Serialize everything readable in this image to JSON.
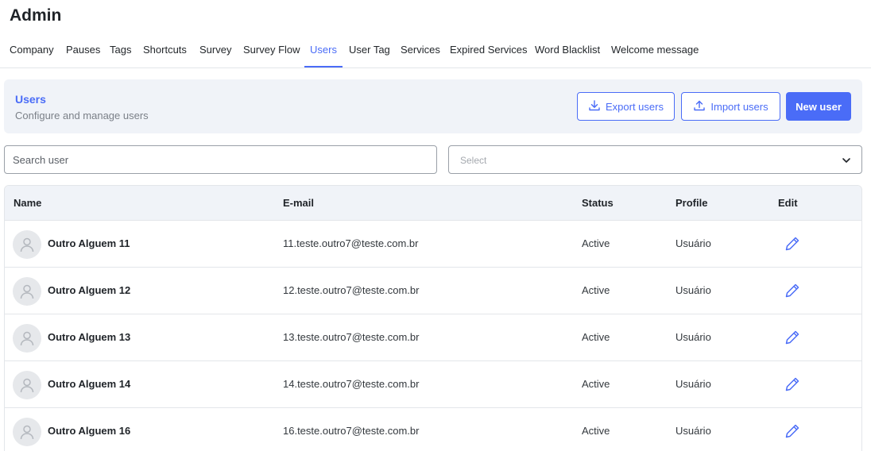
{
  "page": {
    "title": "Admin"
  },
  "tabs": [
    {
      "label": "Company",
      "active": false
    },
    {
      "label": "Pauses",
      "active": false
    },
    {
      "label": "Tags",
      "active": false
    },
    {
      "label": "Shortcuts",
      "active": false
    },
    {
      "label": "Survey",
      "active": false
    },
    {
      "label": "Survey Flow",
      "active": false
    },
    {
      "label": "Users",
      "active": true
    },
    {
      "label": "User Tag",
      "active": false
    },
    {
      "label": "Services",
      "active": false
    },
    {
      "label": "Expired Services",
      "active": false
    },
    {
      "label": "Word Blacklist",
      "active": false
    },
    {
      "label": "Welcome message",
      "active": false
    }
  ],
  "banner": {
    "title": "Users",
    "subtitle": "Configure and manage users",
    "export_label": "Export users",
    "export_icon": "download-icon",
    "import_label": "Import users",
    "import_icon": "upload-icon",
    "new_label": "New user"
  },
  "filters": {
    "search_placeholder": "Search user",
    "select_placeholder": "Select"
  },
  "table": {
    "headers": {
      "name": "Name",
      "email": "E-mail",
      "status": "Status",
      "profile": "Profile",
      "edit": "Edit"
    },
    "rows": [
      {
        "name": "Outro Alguem 11",
        "email": "11.teste.outro7@teste.com.br",
        "status": "Active",
        "profile": "Usuário"
      },
      {
        "name": "Outro Alguem 12",
        "email": "12.teste.outro7@teste.com.br",
        "status": "Active",
        "profile": "Usuário"
      },
      {
        "name": "Outro Alguem 13",
        "email": "13.teste.outro7@teste.com.br",
        "status": "Active",
        "profile": "Usuário"
      },
      {
        "name": "Outro Alguem 14",
        "email": "14.teste.outro7@teste.com.br",
        "status": "Active",
        "profile": "Usuário"
      },
      {
        "name": "Outro Alguem 16",
        "email": "16.teste.outro7@teste.com.br",
        "status": "Active",
        "profile": "Usuário"
      }
    ]
  },
  "colors": {
    "accent": "#4a6cf7",
    "banner_bg": "#f0f3f8",
    "border": "#e3e6ea"
  }
}
